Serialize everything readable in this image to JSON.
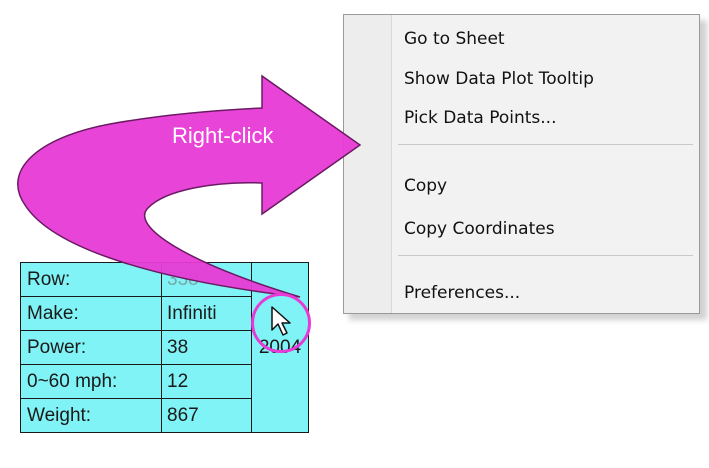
{
  "annotation": {
    "label": "Right-click",
    "arrow_color": "#e83ad6"
  },
  "tooltip": {
    "bg_color": "#7ff3f5",
    "rows": [
      {
        "label": "Row:",
        "value": "338"
      },
      {
        "label": "Make:",
        "value": "Infiniti"
      },
      {
        "label": "Power:",
        "value": "38"
      },
      {
        "label": "0~60 mph:",
        "value": "12"
      },
      {
        "label": "Weight:",
        "value": "867"
      }
    ],
    "extra_value": "2004"
  },
  "context_menu": {
    "items": [
      {
        "label": "Go to Sheet"
      },
      {
        "label": "Show Data Plot Tooltip"
      },
      {
        "label": "Pick Data Points..."
      },
      {
        "label": "Copy"
      },
      {
        "label": "Copy Coordinates"
      },
      {
        "label": "Preferences..."
      }
    ]
  },
  "cursor": {
    "icon": "mouse-pointer-icon"
  }
}
